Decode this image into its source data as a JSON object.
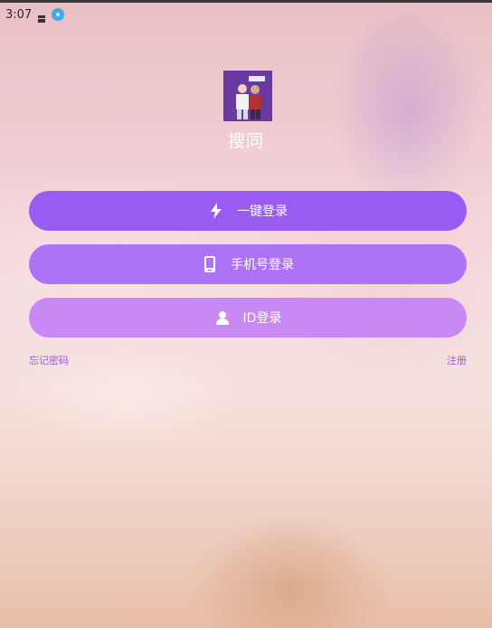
{
  "status_bar": {
    "time": "3:07"
  },
  "app": {
    "name": "搜同"
  },
  "login": {
    "one_click_label": "一键登录",
    "phone_label": "手机号登录",
    "id_label": "ID登录"
  },
  "links": {
    "forgot_password": "忘记密码",
    "register": "注册"
  },
  "colors": {
    "one_click_button": "#9a5bf2",
    "phone_button": "#ad72f6",
    "id_button": "#c889f5",
    "link_text": "#9b5bd6"
  },
  "icons": {
    "one_click": "lightning-icon",
    "phone": "phone-icon",
    "id": "user-icon"
  }
}
